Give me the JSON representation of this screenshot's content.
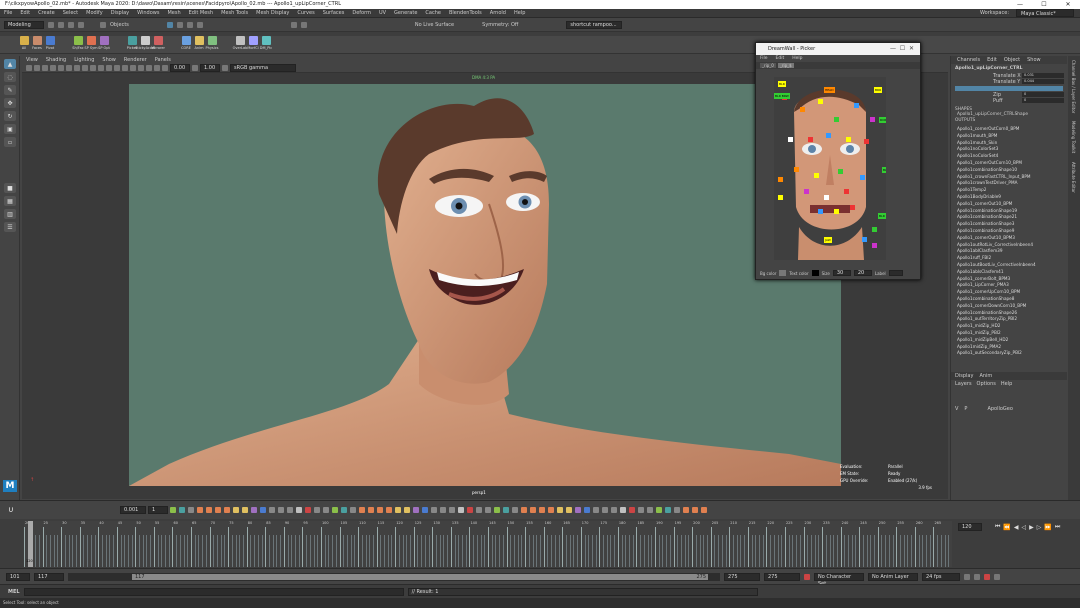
{
  "app": {
    "title": "F:\\cikxpyowApollo_02.mb* - Autodesk Maya 2020: D:\\dawo\\Dasam\\resin\\scenes\\Facidpyro\\Apollo_02.mb   ---   Apollo1_upLipCorner_CTRL",
    "window_controls": [
      "—",
      "☐",
      "✕"
    ]
  },
  "menubar": {
    "items": [
      "File",
      "Edit",
      "Create",
      "Select",
      "Modify",
      "Display",
      "Windows",
      "Mesh",
      "Edit Mesh",
      "Mesh Tools",
      "Mesh Display",
      "Curves",
      "Surfaces",
      "Deform",
      "UV",
      "Generate",
      "Cache",
      "BlendenTools",
      "Arnold",
      "Help"
    ],
    "workspace_label": "Workspace:",
    "workspace_value": "Maya Classic*"
  },
  "statusline": {
    "mode": "Modeling",
    "objects_label": "Objects",
    "live_surface": "No Live Surface",
    "symmetry": "Symmetry: Off",
    "search": "shortcut rampoo..."
  },
  "shelf": {
    "buttons": [
      "All",
      "Faces",
      "Pivot",
      "Sh/Fac",
      "SP Sym",
      "SP Opt",
      "Picker",
      "StickyAccel",
      "Mirrorer",
      "CORE",
      "Anim",
      "Physics",
      "OverLab",
      "MorfCl",
      "DM_Pic"
    ]
  },
  "panel_menu": [
    "View",
    "Shading",
    "Lighting",
    "Show",
    "Renderer",
    "Panels"
  ],
  "panel_fields": {
    "exposure": "0.00",
    "gamma": "1.00",
    "colorspace": "sRGB gamma"
  },
  "viewport": {
    "top_label": "DMA 4:3 PA",
    "camera_label": "persp1",
    "hud": [
      {
        "k": "Evaluation:",
        "v": "Parallel"
      },
      {
        "k": "EM State:",
        "v": "Ready"
      },
      {
        "k": "GPU Override:",
        "v": "Enabled (27/k)"
      }
    ],
    "fps": "3.9 fps"
  },
  "picker": {
    "title": "DreamWall - Picker",
    "menu": [
      "File",
      "Edit",
      "Help"
    ],
    "tabs": [
      "_rip_0",
      "_rip_$"
    ],
    "labels": {
      "l_brow": "BLR",
      "r_brow": "BRR",
      "head": "HEAD",
      "r_col": "ROIB",
      "l_eye_ctrl": "BLR BRW",
      "r_ear": "BLR EAR",
      "nose": "NOSE",
      "jaw": "JAW",
      "r_rot": "BLR ROT"
    },
    "bottom": {
      "bg_label": "Bg color",
      "text_label": "Text color",
      "size_label": "Size",
      "w": "30",
      "h": "20",
      "label_label": "Label"
    }
  },
  "attr": {
    "tabs": [
      "Channels",
      "Edit",
      "Object",
      "Show"
    ],
    "node": "Apollo1_upLipCorner_CTRL",
    "channels": [
      {
        "k": "Translate X",
        "v": "0.031"
      },
      {
        "k": "Translate Y",
        "v": "0.044"
      },
      {
        "k": "Zip",
        "v": "0"
      },
      {
        "k": "Puff",
        "v": "0"
      }
    ],
    "shapes_label": "SHAPES",
    "shape": "Apollo1_upLipCorner_CTRLShape",
    "outputs_label": "OUTPUTS",
    "outputs": [
      "Apollo1_cornerOutCorn0_BPM",
      "Apollo1mouth_BPM",
      "Apollo1mouth_Skin",
      "Apollo1noColorSet3",
      "Apollo1noColorSet4",
      "Apollo1_cornerOutCorn10_BPM",
      "Apollo1combinationShape10",
      "Apollo1_crownFastCTRL_Input_BPM",
      "Apollo1crownTestDriver_PMA",
      "Apollo1Temp2",
      "Apollo1BodyDriable9",
      "Apollo1_cornerOut10_BPM",
      "Apollo1combinationShape19",
      "Apollo1combinationShape21",
      "Apollo1combinationShape3",
      "Apollo1combinationShape9",
      "Apollo1_cornerOut10_BPM3",
      "Apollo1outRotLiv_CorrectiveInbeen4",
      "Apollo1ablClasfiem39",
      "Apollo1ruff_FBI2",
      "Apollo1outBootLiv_CorrectiveInbeen4",
      "Apollo1ablsClasfem41",
      "Apollo1_cornerBolt_BPM3",
      "Apollo1_LipCorner_PMA3",
      "Apollo1_cornerUpCorn10_BPM",
      "Apollo1combinationShape8",
      "Apollo1_cornerDownCorn10_BPM",
      "Apollo1combinationShape26",
      "Apollo1_outTerritoryZip_PBI2",
      "Apollo1_midZip_HD2",
      "Apollo1_midZip_PBI2",
      "Apollo1_midZipBell_HD2",
      "Apollo1midZip_PMA2",
      "Apollo1_outSecondaryZip_PBI2"
    ]
  },
  "layers": {
    "tabs": [
      "Display",
      "Anim"
    ],
    "menu": [
      "Layers",
      "Options",
      "Help"
    ],
    "row": {
      "v": "V",
      "p": "P",
      "name": "ApolloGeo"
    }
  },
  "side_tabs": [
    "Channel Box / Layer Editor",
    "Modeling Toolkit",
    "Attribute Editor"
  ],
  "timeline": {
    "start_field": "0.001",
    "step_field": "1",
    "ticks": [
      "20",
      "25",
      "30",
      "35",
      "40",
      "45",
      "50",
      "55",
      "60",
      "65",
      "70",
      "75",
      "80",
      "85",
      "90",
      "95",
      "100",
      "105",
      "110",
      "115",
      "120",
      "125",
      "130",
      "135",
      "140",
      "145",
      "150",
      "155",
      "160",
      "165",
      "170",
      "175",
      "180",
      "185",
      "190",
      "195",
      "200",
      "205",
      "210",
      "215",
      "220",
      "225",
      "230",
      "235",
      "240",
      "245",
      "250",
      "255",
      "260",
      "265"
    ],
    "current_frame": "120",
    "current_field": "120"
  },
  "range": {
    "start": "101",
    "anim_start": "117",
    "range_label": "117",
    "range_end": "275",
    "end": "275",
    "anim_end": "275",
    "char_set": "No Character Set",
    "anim_layer": "No Anim Layer",
    "fps": "24 fps"
  },
  "cmd": {
    "lang": "MEL",
    "result": "// Result: 1"
  },
  "help": "Select Tool: select an object",
  "colors": {
    "bg": "#444444",
    "select_blue": "#5285a6",
    "viewport_bg": "#5a7a6d",
    "skin": "#d49a7a"
  }
}
